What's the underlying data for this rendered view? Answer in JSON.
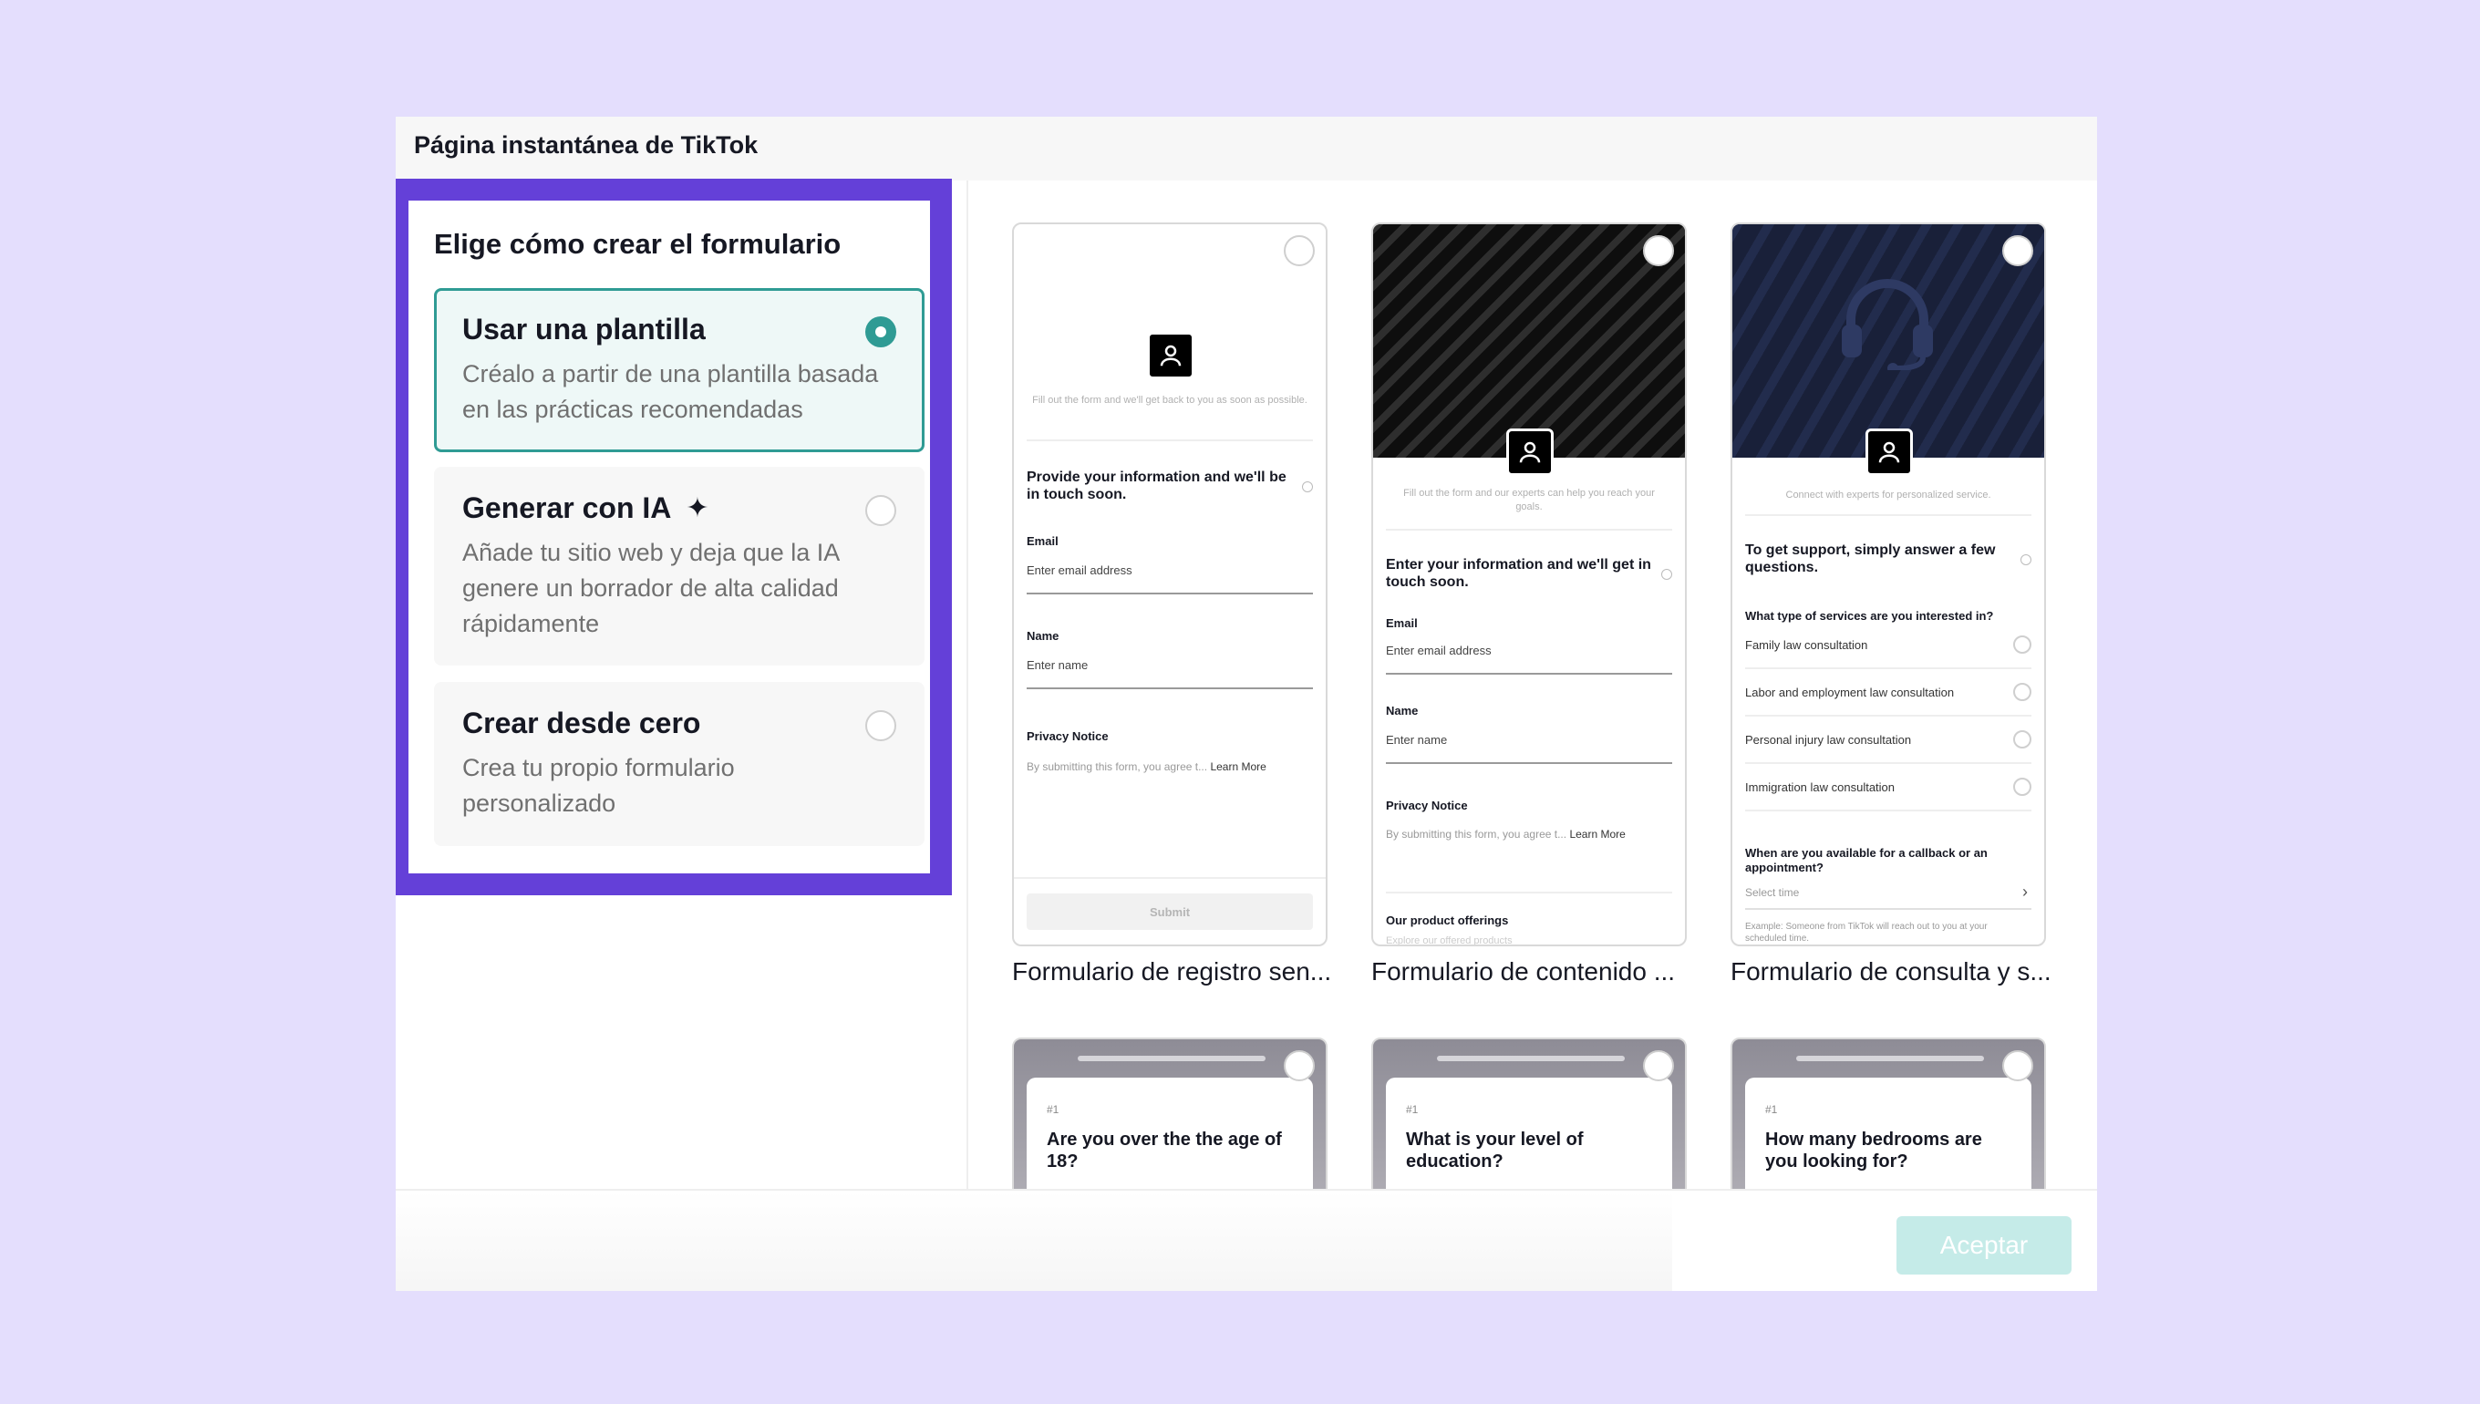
{
  "dialog": {
    "title": "Página instantánea de TikTok"
  },
  "left": {
    "heading": "Elige cómo crear el formulario",
    "options": [
      {
        "title": "Usar una plantilla",
        "desc": "Créalo a partir de una plantilla basada en las prácticas recomendadas",
        "selected": true
      },
      {
        "title": "Generar con IA",
        "icon": "sparkle-icon",
        "desc": "Añade tu sitio web y deja que la IA genere un borrador de alta calidad rápidamente",
        "selected": false
      },
      {
        "title": "Crear desde cero",
        "desc": "Crea tu propio formulario personalizado",
        "selected": false
      }
    ]
  },
  "templates": [
    {
      "caption": "Formulario de registro sen...",
      "sub": "Fill out the form and we'll get back to you as soon as possible.",
      "heading": "Provide your information and we'll be in touch soon.",
      "email_label": "Email",
      "email_ph": "Enter email address",
      "name_label": "Name",
      "name_ph": "Enter name",
      "privacy_label": "Privacy Notice",
      "privacy_text": "By submitting this form, you agree t...",
      "learn_more": "Learn More",
      "submit": "Submit"
    },
    {
      "caption": "Formulario de contenido ...",
      "sub": "Fill out the form and our experts can help you reach your goals.",
      "heading": "Enter your information and we'll get in touch soon.",
      "email_label": "Email",
      "email_ph": "Enter email address",
      "name_label": "Name",
      "name_ph": "Enter name",
      "privacy_label": "Privacy Notice",
      "privacy_text": "By submitting this form, you agree t...",
      "learn_more": "Learn More",
      "offerings_label": "Our product offerings",
      "offerings_sub": "Explore our offered products"
    },
    {
      "caption": "Formulario de consulta y s...",
      "sub": "Connect with experts for personalized service.",
      "heading": "To get support, simply answer a few questions.",
      "question": "What type of services are you interested in?",
      "choices": [
        "Family law consultation",
        "Labor and employment law consultation",
        "Personal injury law consultation",
        "Immigration law consultation"
      ],
      "availability": "When are you available for a callback or an appointment?",
      "select_time": "Select time",
      "example": "Example: Someone from TikTok will reach out to you at your scheduled time."
    }
  ],
  "quiz_templates": [
    {
      "num": "#1",
      "question": "Are you over the the age of 18?"
    },
    {
      "num": "#1",
      "question": "What is your level of education?"
    },
    {
      "num": "#1",
      "question": "How many bedrooms are you looking for?"
    }
  ],
  "footer": {
    "accept": "Aceptar"
  },
  "colors": {
    "highlight": "#6440d8",
    "accent": "#2f9b94",
    "accept_disabled": "#c5ebe8",
    "background": "#e4defd"
  }
}
